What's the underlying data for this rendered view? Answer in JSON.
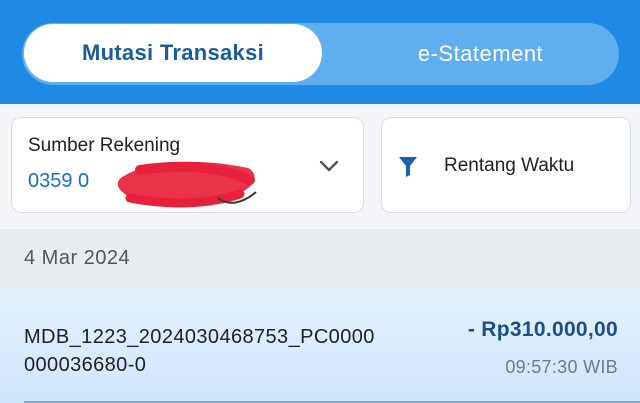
{
  "tabs": [
    {
      "label": "Mutasi Transaksi",
      "active": true
    },
    {
      "label": "e-Statement",
      "active": false
    }
  ],
  "account_selector": {
    "label": "Sumber Rekening",
    "number_visible": "0359 0"
  },
  "range_filter": {
    "label": "Rentang Waktu",
    "icon": "filter-icon"
  },
  "date_group": {
    "date": "4 Mar 2024"
  },
  "transaction": {
    "description": "MDB_1223_2024030468753_PC0000000036680-0",
    "amount": "- Rp310.000,00",
    "time": "09:57:30 WIB"
  },
  "colors": {
    "header_blue": "#1e8ae3",
    "accent_blue": "#1a6fc0",
    "amount_blue": "#1a4f8a",
    "redaction_red": "#e8213b"
  }
}
